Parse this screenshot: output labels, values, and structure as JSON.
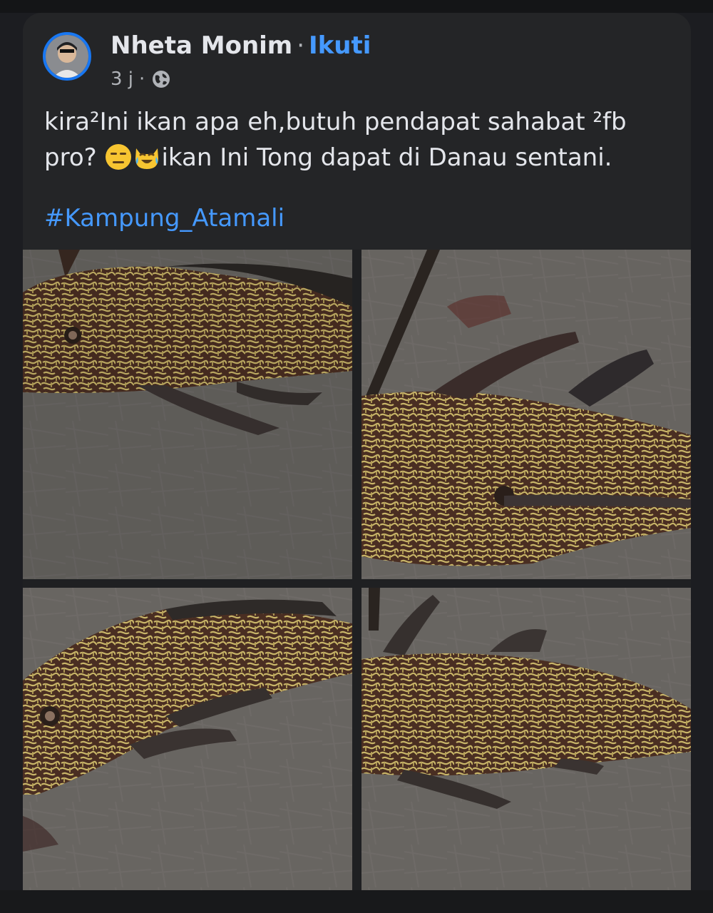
{
  "post": {
    "author": "Nheta Monim",
    "follow_label": "Ikuti",
    "separator": "·",
    "time": "3 j",
    "meta_separator": "·",
    "audience_icon": "globe-icon",
    "text_line1": "kira²Ini ikan apa eh,butuh pendapat sahabat ²fb",
    "text_line2_before": "pro?",
    "emoji1": "expressionless-face",
    "emoji2": "crying-laughing-cat",
    "text_line2_after": "ikan Ini Tong dapat di Danau sentani.",
    "hashtag": "#Kampung_Atamali"
  },
  "photos": [
    {
      "subject": "fish-photo-1"
    },
    {
      "subject": "fish-photo-2"
    },
    {
      "subject": "fish-photo-3"
    },
    {
      "subject": "fish-photo-4"
    }
  ],
  "colors": {
    "background": "#1c1d21",
    "card": "#242527",
    "link": "#4599ff",
    "text": "#e4e6eb",
    "muted": "#b0b3b8",
    "avatar_ring": "#1877f2"
  }
}
